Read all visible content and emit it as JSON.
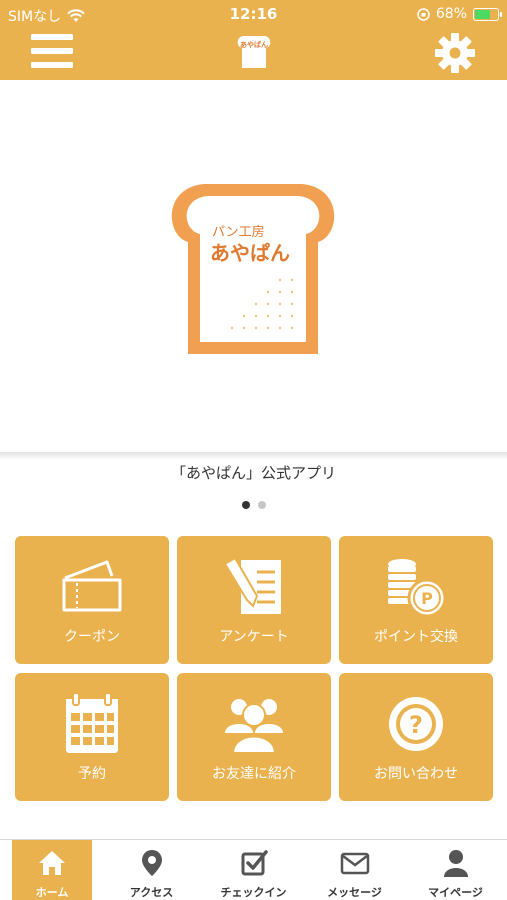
{
  "status_bar": {
    "carrier": "SIMなし",
    "time": "12:16",
    "battery_percent": "68%",
    "battery_level": 0.68,
    "icons": [
      "wifi-icon",
      "orientation-lock-icon",
      "battery-charging-icon"
    ]
  },
  "header": {
    "logo_text": "あやぱん",
    "icons": [
      "hamburger-menu-icon",
      "gear-icon"
    ]
  },
  "hero": {
    "logo_line1": "パン工房",
    "logo_line2": "あやぱん"
  },
  "app_title": "「あやぱん」公式アプリ",
  "pager": {
    "count": 2,
    "active": 1
  },
  "tiles": [
    {
      "label": "クーポン",
      "icon": "ticket-icon"
    },
    {
      "label": "アンケート",
      "icon": "survey-pencil-icon"
    },
    {
      "label": "ポイント交換",
      "icon": "coins-point-icon"
    },
    {
      "label": "予約",
      "icon": "calendar-icon"
    },
    {
      "label": "お友達に紹介",
      "icon": "people-icon"
    },
    {
      "label": "お問い合わせ",
      "icon": "question-icon"
    }
  ],
  "tabbar": {
    "items": [
      {
        "label": "ホーム",
        "icon": "home-icon",
        "active": true
      },
      {
        "label": "アクセス",
        "icon": "map-pin-icon"
      },
      {
        "label": "チェックイン",
        "icon": "checkin-icon"
      },
      {
        "label": "メッセージ",
        "icon": "envelope-icon"
      },
      {
        "label": "マイページ",
        "icon": "user-icon"
      }
    ]
  },
  "colors": {
    "accent": "#e9b24e",
    "logo_orange": "#f0a050",
    "text": "#333333"
  }
}
